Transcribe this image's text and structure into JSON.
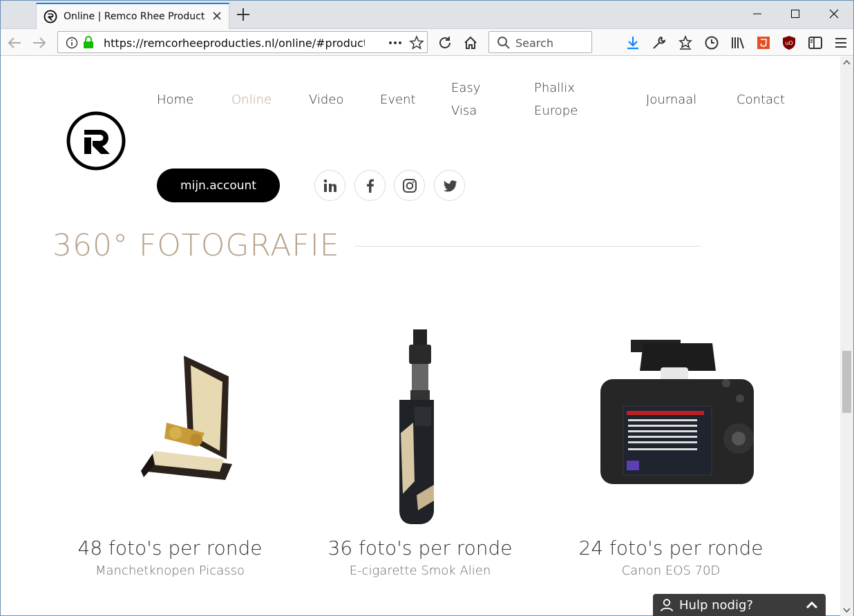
{
  "browser": {
    "tab_title": "Online | Remco Rhee Producties",
    "url": "https://remcorheeproducties.nl/online/#productp",
    "search_placeholder": "Search"
  },
  "nav": {
    "items": [
      {
        "label": "Home"
      },
      {
        "label": "Online",
        "active": true
      },
      {
        "label": "Video"
      },
      {
        "label": "Event"
      },
      {
        "label": "Easy Visa"
      },
      {
        "label": "Phallix Europe"
      },
      {
        "label": "Journaal"
      },
      {
        "label": "Contact"
      }
    ],
    "account_label": "mijn.account",
    "social": [
      "linkedin-icon",
      "facebook-icon",
      "instagram-icon",
      "twitter-icon"
    ]
  },
  "section": {
    "title": "360° FOTOGRAFIE"
  },
  "products": [
    {
      "count": "48 foto's per ronde",
      "name": "Manchetknopen Picasso"
    },
    {
      "count": "36 foto's per ronde",
      "name": "E-cigarette Smok Alien"
    },
    {
      "count": "24 foto's per ronde",
      "name": "Canon EOS 70D"
    }
  ],
  "help": {
    "label": "Hulp nodig?"
  },
  "colors": {
    "accent": "#b7a28c",
    "button": "#000000",
    "tab_highlight": "#0a84ff"
  }
}
